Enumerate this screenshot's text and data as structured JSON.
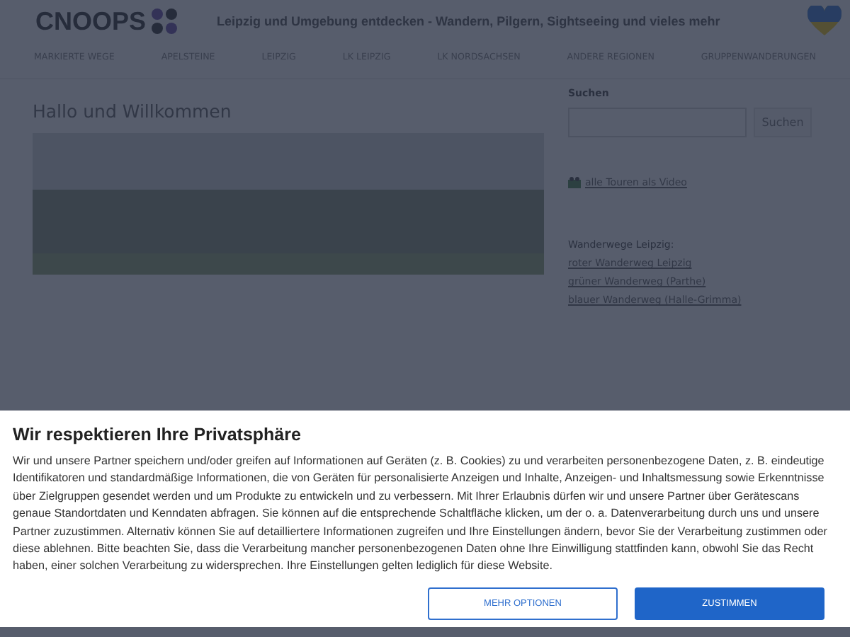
{
  "header": {
    "logo": "CNOOPS",
    "tagline": "Leipzig und Umgebung entdecken - Wandern, Pilgern, Sightseeing und vieles mehr"
  },
  "nav": [
    "MARKIERTE WEGE",
    "APELSTEINE",
    "LEIPZIG",
    "LK LEIPZIG",
    "LK NORDSACHSEN",
    "ANDERE REGIONEN",
    "GRUPPENWANDERUNGEN"
  ],
  "main": {
    "title": "Hallo und Willkommen"
  },
  "sidebar": {
    "search_label": "Suchen",
    "search_button": "Suchen",
    "video_link": "alle Touren als Video",
    "routes_heading": "Wanderwege Leipzig:",
    "routes": [
      "roter Wanderweg Leipzig",
      "grüner Wanderweg (Parthe)",
      "blauer Wanderweg (Halle-Grimma)"
    ]
  },
  "consent": {
    "title": "Wir respektieren Ihre Privatsphäre",
    "text": "Wir und unsere Partner speichern und/oder greifen auf Informationen auf Geräten (z. B. Cookies) zu und verarbeiten personenbezogene Daten, z. B. eindeutige Identifikatoren und standardmäßige Informationen, die von Geräten für personalisierte Anzeigen und Inhalte, Anzeigen- und Inhaltsmessung sowie Erkenntnisse über Zielgruppen gesendet werden und um Produkte zu entwickeln und zu verbessern. Mit Ihrer Erlaubnis dürfen wir und unsere Partner über Gerätescans genaue Standortdaten und Kenndaten abfragen. Sie können auf die entsprechende Schaltfläche klicken, um der o. a. Datenverarbeitung durch uns und unsere Partner zuzustimmen. Alternativ können Sie auf detailliertere Informationen zugreifen und Ihre Einstellungen ändern, bevor Sie der Verarbeitung zustimmen oder diese ablehnen. Bitte beachten Sie, dass die Verarbeitung mancher personenbezogenen Daten ohne Ihre Einwilligung stattfinden kann, obwohl Sie das Recht haben, einer solchen Verarbeitung zu widersprechen. Ihre Einstellungen gelten lediglich für diese Website.",
    "buttons": [
      {
        "label": "MEHR OPTIONEN",
        "kind": "secondary"
      },
      {
        "label": "ZUSTIMMEN",
        "kind": "primary"
      }
    ]
  }
}
